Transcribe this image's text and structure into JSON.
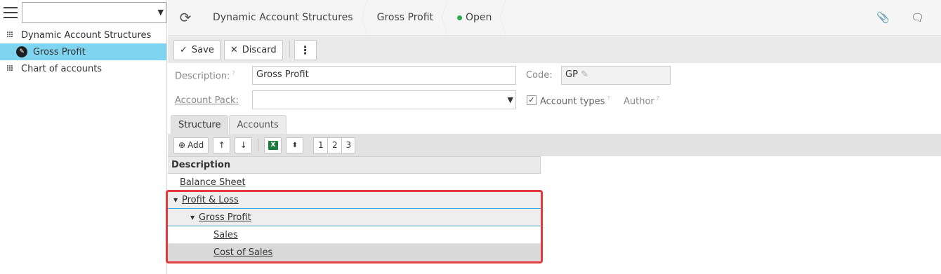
{
  "sidebar": {
    "select_value": "",
    "items": [
      {
        "label": "Dynamic Account Structures",
        "icon": "grid-icon"
      },
      {
        "label": "Gross Profit",
        "icon": "pencil-icon",
        "active": true
      },
      {
        "label": "Chart of accounts",
        "icon": "grid-icon"
      }
    ]
  },
  "header": {
    "crumbs": [
      "Dynamic Account Structures",
      "Gross Profit"
    ],
    "status": "Open",
    "status_color": "#2aa84a"
  },
  "toolbar": {
    "save_label": "Save",
    "discard_label": "Discard",
    "more_label": "⋮"
  },
  "form": {
    "description_label": "Description:",
    "description_value": "Gross Profit",
    "code_label": "Code:",
    "code_value": "GP",
    "account_pack_label": "Account Pack:",
    "account_pack_value": "",
    "account_types_label": "Account types",
    "account_types_checked": true,
    "author_label": "Author",
    "help_mark": "?"
  },
  "tabs": [
    "Structure",
    "Accounts"
  ],
  "subtoolbar": {
    "add_label": "Add",
    "levels": [
      "1",
      "2",
      "3"
    ]
  },
  "grid": {
    "header": "Description",
    "rows": [
      {
        "label": "Balance Sheet",
        "level": 0,
        "expandable": false
      },
      {
        "label": "Profit & Loss",
        "level": 0,
        "expandable": true
      },
      {
        "label": "Gross Profit",
        "level": 1,
        "expandable": true
      },
      {
        "label": "Sales",
        "level": 2,
        "expandable": false
      },
      {
        "label": "Cost of Sales",
        "level": 2,
        "expandable": false
      }
    ]
  },
  "colors": {
    "active_sidebar": "#7fd4ef",
    "highlight_border": "#e0393e",
    "selection_line": "#3ba7d6"
  }
}
